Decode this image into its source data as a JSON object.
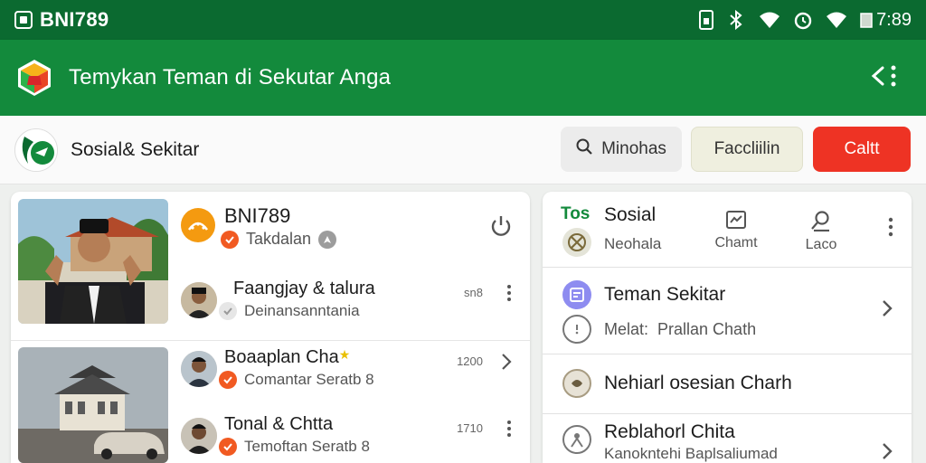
{
  "status_bar": {
    "carrier": "BNI789",
    "time": "7:89"
  },
  "app_bar": {
    "title": "Temykan Teman di Sekutar Anga"
  },
  "toolbar": {
    "brand": "Sosial& Sekitar",
    "search_label": "Minohas",
    "filter_label": "Faccliilin",
    "chat_label": "Caltt"
  },
  "left_panel": {
    "profile": {
      "name": "BNI789",
      "status": "Takdalan"
    },
    "rows": [
      {
        "name": "Faangjay & talura",
        "sub": "Deinansanntania",
        "meta": "sn8",
        "star": ""
      },
      {
        "name": "Boaaplan Cha",
        "sub": "Comantar Seratb 8",
        "meta": "1200",
        "star": "★"
      },
      {
        "name": "Tonal & Chtta",
        "sub": "Temoftan Seratb 8",
        "meta": "1710",
        "star": ""
      }
    ]
  },
  "right_panel": {
    "tag": "Tos",
    "title": "Sosial",
    "subtitle": "Neohala",
    "tools": {
      "chat": "Chamt",
      "location": "Laco"
    },
    "items": [
      {
        "title": "Teman Sekitar",
        "sub": "Melat: ​ Prallan Chath"
      },
      {
        "title": "Nehiarl osesian Charh"
      },
      {
        "title": "Reblahorl Chita",
        "sub": "Kanokntehi Baplsaliumad"
      }
    ]
  },
  "colors": {
    "status_bar": "#0b6a30",
    "app_bar": "#138a3c",
    "accent_red": "#ee3324",
    "badge_orange": "#f15a22",
    "avatar_orange": "#f49a10"
  },
  "icons": {
    "status": [
      "sim-icon",
      "bluetooth-icon",
      "wifi-icon",
      "alarm-icon",
      "wifi-icon",
      "battery-icon"
    ],
    "app_bar": [
      "app-logo",
      "back-icon"
    ],
    "toolbar": [
      "search-icon"
    ],
    "left_panel": [
      "power-icon",
      "kebab-icon",
      "chevron-right-icon"
    ],
    "right_panel": [
      "chat-icon",
      "location-icon",
      "kebab-icon",
      "chevron-right-icon"
    ]
  }
}
